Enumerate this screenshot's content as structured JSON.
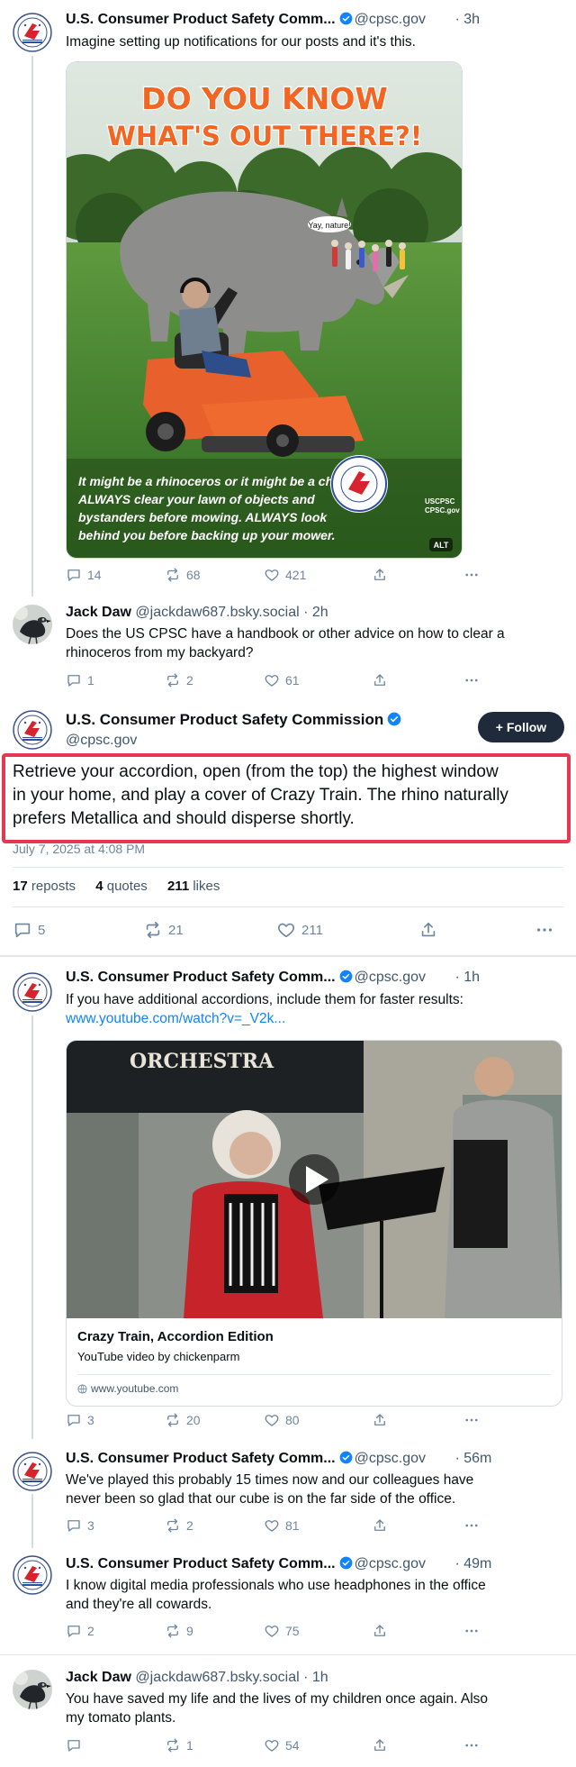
{
  "posts": {
    "p1": {
      "name": "U.S. Consumer Product Safety Comm...",
      "handle": "@cpsc.gov",
      "time": "· 3h",
      "text": "Imagine setting up notifications for our posts and it's this.",
      "image": {
        "headline_1": "DO YOU KNOW",
        "headline_2": "WHAT'S OUT THERE?!",
        "bubble": "Yay, nature!",
        "caption_1": "It might be a rhinoceros or it might be a child.",
        "caption_2": "ALWAYS clear your lawn of objects and",
        "caption_3": "bystanders before mowing. ALWAYS look",
        "caption_4": "behind you before backing up your mower.",
        "badge_1": "USCPSC",
        "badge_2": "CPSC.gov",
        "alt": "ALT"
      },
      "replies": "14",
      "reposts": "68",
      "likes": "421"
    },
    "p2": {
      "name": "Jack Daw",
      "handle": "@jackdaw687.bsky.social",
      "time": "· 2h",
      "text_1": "Does the US CPSC have a handbook or other advice on how to clear a",
      "text_2": "rhinoceros from my backyard?",
      "replies": "1",
      "reposts": "2",
      "likes": "61"
    },
    "main": {
      "name": "U.S. Consumer Product Safety Commission",
      "handle": "@cpsc.gov",
      "follow": "+ Follow",
      "text_1": "Retrieve your accordion, open (from the top) the highest window",
      "text_2": "in your home, and play a cover of Crazy Train. The rhino naturally",
      "text_3": "prefers Metallica and should disperse shortly.",
      "date": "July 7, 2025 at 4:08 PM",
      "repost_count": "17",
      "repost_label": "reposts",
      "quote_count": "4",
      "quote_label": "quotes",
      "like_count": "211",
      "like_label": "likes",
      "replies": "5",
      "reposts": "21",
      "likes": "211"
    },
    "p3": {
      "name": "U.S. Consumer Product Safety Comm...",
      "handle": "@cpsc.gov",
      "time": "· 1h",
      "text": "If you have additional accordions, include them for faster results:",
      "link": "www.youtube.com/watch?v=_V2k...",
      "video_banner": "ORCHESTRA",
      "card_title": "Crazy Train, Accordion Edition",
      "card_desc": "YouTube video by chickenparm",
      "card_domain": "www.youtube.com",
      "replies": "3",
      "reposts": "20",
      "likes": "80"
    },
    "p4": {
      "name": "U.S. Consumer Product Safety Comm...",
      "handle": "@cpsc.gov",
      "time": "· 56m",
      "text_1": "We've played this probably 15 times now and our colleagues have",
      "text_2": "never been so glad that our cube is on the far side of the office.",
      "replies": "3",
      "reposts": "2",
      "likes": "81"
    },
    "p5": {
      "name": "U.S. Consumer Product Safety Comm...",
      "handle": "@cpsc.gov",
      "time": "· 49m",
      "text_1": "I know digital media professionals who use headphones in the office",
      "text_2": "and they're all cowards.",
      "replies": "2",
      "reposts": "9",
      "likes": "75"
    },
    "p6": {
      "name": "Jack Daw",
      "handle": "@jackdaw687.bsky.social",
      "time": "· 1h",
      "text_1": "You have saved my life and the lives of my children once again. Also",
      "text_2": "my tomato plants.",
      "replies": "",
      "reposts": "1",
      "likes": "54"
    }
  },
  "colors": {
    "accent": "#1083fe",
    "highlight": "#e8384f",
    "muted": "#42576c",
    "follow_bg": "#1f2b3a"
  },
  "icons": [
    "reply-icon",
    "repost-icon",
    "like-icon",
    "share-icon",
    "more-icon",
    "verified-icon",
    "play-icon",
    "globe-icon"
  ]
}
